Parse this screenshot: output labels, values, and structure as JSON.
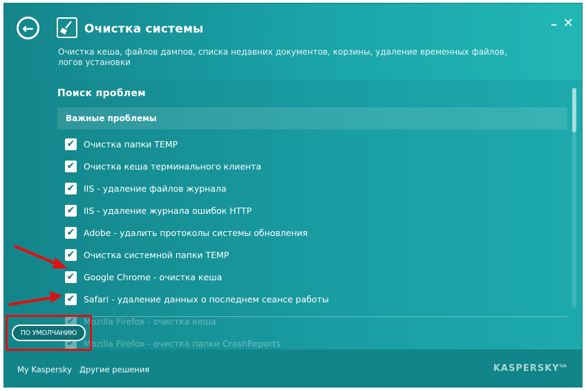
{
  "window": {
    "title": "Очистка системы",
    "subtitle": "Очистка кеша, файлов дампов, списка недавних документов, корзины, удаление временных файлов, логов установки",
    "back_icon": "arrow-left-icon",
    "app_icon": "broom-icon",
    "minimize_label": "–",
    "close_label": "✕"
  },
  "main": {
    "section_title": "Поиск проблем",
    "group_header": "Важные проблемы",
    "check_mark": "✔",
    "items": [
      {
        "label": "Очистка папки TEMP",
        "checked": true
      },
      {
        "label": "Очистка кеша терминального клиента",
        "checked": true
      },
      {
        "label": "IIS - удаление файлов журнала",
        "checked": true
      },
      {
        "label": "IIS - удаление журнала ошибок HTTP",
        "checked": true
      },
      {
        "label": "Adobe - удалить протоколы системы обновления",
        "checked": true
      },
      {
        "label": "Очистка системной папки TEMP",
        "checked": true
      },
      {
        "label": "Google Chrome - очистка кеша",
        "checked": true
      },
      {
        "label": "Safari - удаление данных о последнем сеансе работы",
        "checked": true
      },
      {
        "label": "Mozilla Firefox - очистка кеша",
        "checked": true
      },
      {
        "label": "Mozilla Firefox - очистка папки CrashReports",
        "checked": true
      }
    ]
  },
  "default_button": {
    "label": "ПО УМОЛЧАНИЮ"
  },
  "footer": {
    "my_kaspersky": "My Kaspersky",
    "other_solutions": "Другие решения",
    "brand": "KASPERSKY",
    "brand_suffix": "lab"
  },
  "colors": {
    "accent": "#169ba0",
    "annotation": "#e01010"
  }
}
